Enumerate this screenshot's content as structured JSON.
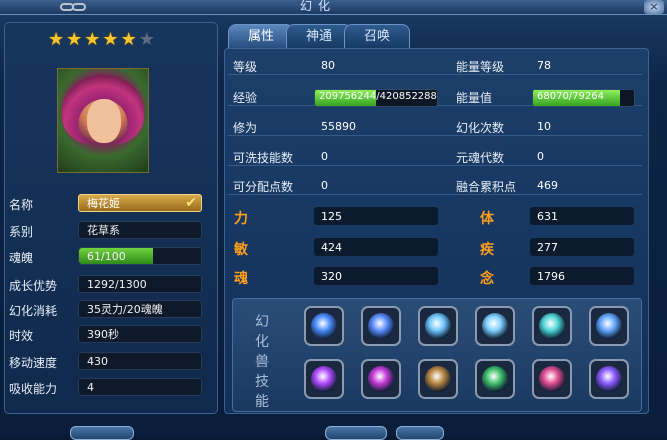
{
  "window": {
    "title": "幻化"
  },
  "left": {
    "stars_filled": 5,
    "stars_total": 6,
    "fields": [
      {
        "label": "名称",
        "value": "梅花姬"
      },
      {
        "label": "系别",
        "value": "花草系"
      },
      {
        "label": "魂魄",
        "value": "61/100",
        "fill": 0.61
      },
      {
        "label": "成长优势",
        "value": "1292/1300"
      },
      {
        "label": "幻化消耗",
        "value": "35灵力/20魂魄"
      },
      {
        "label": "时效",
        "value": "390秒"
      },
      {
        "label": "移动速度",
        "value": "430"
      },
      {
        "label": "吸收能力",
        "value": "4"
      }
    ]
  },
  "tabs": [
    {
      "label": "属性",
      "active": true
    },
    {
      "label": "神通",
      "active": false
    },
    {
      "label": "召唤",
      "active": false
    }
  ],
  "stats": {
    "rows": [
      {
        "l1": "等级",
        "v1": "80",
        "l2": "能量等级",
        "v2": "78"
      },
      {
        "l1": "经验",
        "v1": "209756244/420852288",
        "fill1": 0.4984,
        "l2": "能量值",
        "v2": "68070/79264",
        "fill2": 0.8588
      },
      {
        "l1": "修为",
        "v1": "55890",
        "l2": "幻化次数",
        "v2": "10"
      },
      {
        "l1": "可洗技能数",
        "v1": "0",
        "l2": "元魂代数",
        "v2": "0"
      },
      {
        "l1": "可分配点数",
        "v1": "0",
        "l2": "融合累积点",
        "v2": "469"
      }
    ],
    "attributes": [
      {
        "l1": "力",
        "v1": "125",
        "l2": "体",
        "v2": "631"
      },
      {
        "l1": "敏",
        "v1": "424",
        "l2": "疾",
        "v2": "277"
      },
      {
        "l1": "魂",
        "v1": "320",
        "l2": "念",
        "v2": "1796"
      }
    ]
  },
  "skills": {
    "label": "幻化兽技能",
    "icons": [
      {
        "name": "blue-orb-skill-icon",
        "color": "#4b8cff"
      },
      {
        "name": "blue-orb-skill-icon",
        "color": "#5a8dff"
      },
      {
        "name": "ice-spike-skill-icon",
        "color": "#6fc7ff"
      },
      {
        "name": "ice-spike-skill-icon",
        "color": "#7fd0ff"
      },
      {
        "name": "ice-dragon-skill-icon",
        "color": "#4fd6d6"
      },
      {
        "name": "frost-burst-skill-icon",
        "color": "#63a8ff"
      },
      {
        "name": "purple-shield-skill-icon",
        "color": "#b14bff"
      },
      {
        "name": "purple-swirl-skill-icon",
        "color": "#c23bd6"
      },
      {
        "name": "earth-hand-skill-icon",
        "color": "#b8853f"
      },
      {
        "name": "green-figure-skill-icon",
        "color": "#3fbf6a"
      },
      {
        "name": "pink-heart-skill-icon",
        "color": "#e04b8f"
      },
      {
        "name": "violet-rune-skill-icon",
        "color": "#8b5bff"
      }
    ]
  }
}
